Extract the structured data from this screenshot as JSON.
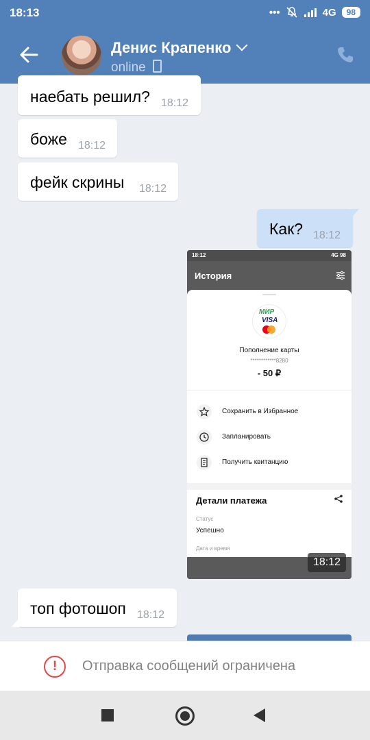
{
  "status_bar": {
    "time": "18:13",
    "network": "4G",
    "battery": "98"
  },
  "header": {
    "name": "Денис Крапенко",
    "presence": "online"
  },
  "messages": [
    {
      "text": "наебать решил?",
      "time": "18:12"
    },
    {
      "text": "боже",
      "time": "18:12"
    },
    {
      "text": "фейк скрины",
      "time": "18:12"
    },
    {
      "text": "Как?",
      "time": "18:12"
    },
    {
      "text": "топ фотошоп",
      "time": "18:12"
    }
  ],
  "screenshot": {
    "status_time": "18:12",
    "status_right": "4G 98",
    "app_title": "История",
    "card_brands": {
      "mir": "МИР",
      "visa": "VISA"
    },
    "operation": "Пополнение карты",
    "card_number": "************8280",
    "amount": "- 50 ₽",
    "actions": [
      "Сохранить в Избранное",
      "Запланировать",
      "Получить квитанцию"
    ],
    "details_title": "Детали платежа",
    "status_label": "Статус",
    "status_value": "Успешно",
    "date_label": "Дата и время",
    "time": "18:12"
  },
  "restriction": {
    "text": "Отправка сообщений ограничена"
  },
  "colors": {
    "header": "#5181b8",
    "incoming": "#ffffff",
    "outgoing": "#cce0f8",
    "warning": "#e64646"
  }
}
